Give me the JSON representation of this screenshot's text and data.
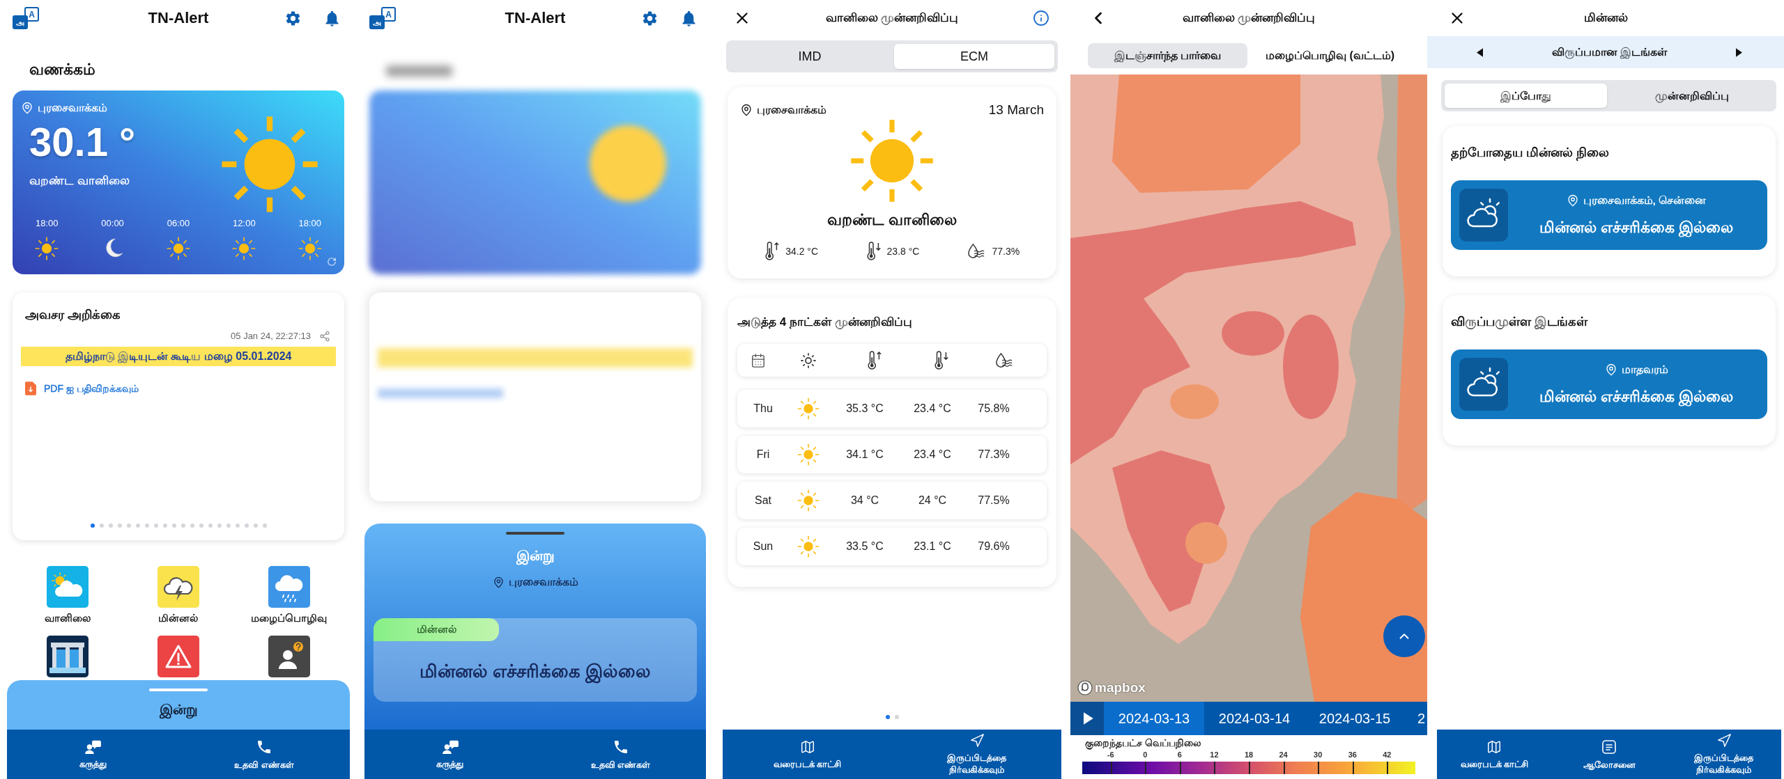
{
  "home": {
    "app_bar": {
      "language_glyphs": [
        "அ",
        "A"
      ],
      "title": "TN-Alert"
    },
    "greeting": "வணக்கம்",
    "weather_card": {
      "location": "புரசைவாக்கம்",
      "temperature": "30.1 °",
      "condition": "வறண்ட வானிலை",
      "hourly": [
        {
          "time": "18:00",
          "kind": "sun"
        },
        {
          "time": "00:00",
          "kind": "moon"
        },
        {
          "time": "06:00",
          "kind": "sun"
        },
        {
          "time": "12:00",
          "kind": "sun"
        },
        {
          "time": "18:00",
          "kind": "sun"
        }
      ]
    },
    "alert_card": {
      "title": "அவசர அறிக்கை",
      "timestamp": "05 Jan 24, 22:27:13",
      "banner": "தமிழ்நாடு இடியுடன் கூடிய மழை 05.01.2024",
      "download_link": "PDF ஐ பதிவிறக்கவும்",
      "pages": [
        {
          "selected": true
        },
        {
          "selected": false
        },
        {
          "selected": false
        },
        {
          "selected": false
        },
        {
          "selected": false
        },
        {
          "selected": false
        },
        {
          "selected": false
        },
        {
          "selected": false
        },
        {
          "selected": false
        },
        {
          "selected": false
        },
        {
          "selected": false
        },
        {
          "selected": false
        },
        {
          "selected": false
        },
        {
          "selected": false
        },
        {
          "selected": false
        },
        {
          "selected": false
        },
        {
          "selected": false
        },
        {
          "selected": false
        },
        {
          "selected": false
        },
        {
          "selected": false
        }
      ]
    },
    "tiles": [
      {
        "kind": "weather",
        "label": "வானிலை"
      },
      {
        "kind": "lightning",
        "label": "மின்னல்"
      },
      {
        "kind": "rain",
        "label": "மழைப்பொழிவு"
      },
      {
        "kind": "dam"
      },
      {
        "kind": "warning"
      },
      {
        "kind": "contact"
      }
    ],
    "bottom_sheet": {
      "title": "இன்று"
    },
    "nav": [
      {
        "kind": "feedback",
        "label": "கருத்து"
      },
      {
        "kind": "phone",
        "label": "உதவி எண்கள்"
      }
    ]
  },
  "today_sheet": {
    "app_bar": {
      "language_glyphs": [
        "அ",
        "A"
      ],
      "title": "TN-Alert"
    },
    "sheet": {
      "title": "இன்று",
      "location": "புரசைவாக்கம்",
      "alert": {
        "tag": "மின்னல்",
        "message": "மின்னல் எச்சரிக்கை இல்லை"
      }
    },
    "nav": [
      {
        "kind": "feedback",
        "label": "கருத்து"
      },
      {
        "kind": "phone",
        "label": "உதவி எண்கள்"
      }
    ]
  },
  "forecast": {
    "title": "வானிலை முன்னறிவிப்பு",
    "sources": [
      {
        "label": "IMD",
        "selected": false
      },
      {
        "label": "ECM",
        "selected": true
      }
    ],
    "today": {
      "location": "புரசைவாக்கம்",
      "date": "13 March",
      "condition": "வறண்ட வானிலை",
      "stats": [
        {
          "kind": "max",
          "value": "34.2 °C"
        },
        {
          "kind": "min",
          "value": "23.8 °C"
        },
        {
          "kind": "humidity",
          "value": "77.3%"
        }
      ]
    },
    "outlook": {
      "title": "அடுத்த 4 நாட்கள் முன்னறிவிப்பு",
      "rows": [
        {
          "day": "Thu",
          "max": "35.3 °C",
          "min": "23.4 °C",
          "humidity": "75.8%"
        },
        {
          "day": "Fri",
          "max": "34.1 °C",
          "min": "23.4 °C",
          "humidity": "77.3%"
        },
        {
          "day": "Sat",
          "max": "34 °C",
          "min": "24 °C",
          "humidity": "77.5%"
        },
        {
          "day": "Sun",
          "max": "33.5 °C",
          "min": "23.1 °C",
          "humidity": "79.6%"
        }
      ]
    },
    "pages": [
      {
        "selected": true
      },
      {
        "selected": false
      }
    ],
    "nav": [
      {
        "kind": "map",
        "label": "வரைபடக் காட்சி"
      },
      {
        "kind": "location",
        "label": "இருப்பிடத்தை நிர்வகிக்கவும்"
      }
    ]
  },
  "map_view": {
    "title": "வானிலை முன்னறிவிப்பு",
    "tabs": [
      {
        "label": "இடஞ்சார்ந்த பார்வை",
        "selected": true
      },
      {
        "label": "மழைப்பொழிவு (வட்டம்)",
        "selected": false
      }
    ],
    "attribution": "mapbox",
    "dates": [
      {
        "label": "2024-03-13",
        "selected": true
      },
      {
        "label": "2024-03-14",
        "selected": false
      },
      {
        "label": "2024-03-15",
        "selected": false
      },
      {
        "label": "2",
        "selected": false
      }
    ],
    "legend": {
      "title": "குறைந்தபட்ச வெப்பநிலை",
      "ticks": [
        "-6",
        "0",
        "6",
        "12",
        "18",
        "24",
        "30",
        "36",
        "42"
      ]
    }
  },
  "lightning": {
    "title": "மின்னல்",
    "location_group": "விருப்பமான இடங்கள்",
    "tabs": [
      {
        "label": "இப்போது",
        "selected": true
      },
      {
        "label": "முன்னறிவிப்பு",
        "selected": false
      }
    ],
    "sections": [
      {
        "title": "தற்போதைய மின்னல் நிலை",
        "locations": [
          {
            "place": "புரசைவாக்கம், சென்னை",
            "status": "மின்னல் எச்சரிக்கை இல்லை"
          }
        ]
      },
      {
        "title": "விருப்பமுள்ள இடங்கள்",
        "locations": [
          {
            "place": "மாதவரம்",
            "status": "மின்னல் எச்சரிக்கை இல்லை"
          }
        ]
      }
    ],
    "nav": [
      {
        "kind": "map",
        "label": "வரைபடக் காட்சி"
      },
      {
        "kind": "advisory",
        "label": "ஆலோசனை"
      },
      {
        "kind": "location",
        "label": "இருப்பிடத்தை நிர்வகிக்கவும்"
      }
    ]
  }
}
